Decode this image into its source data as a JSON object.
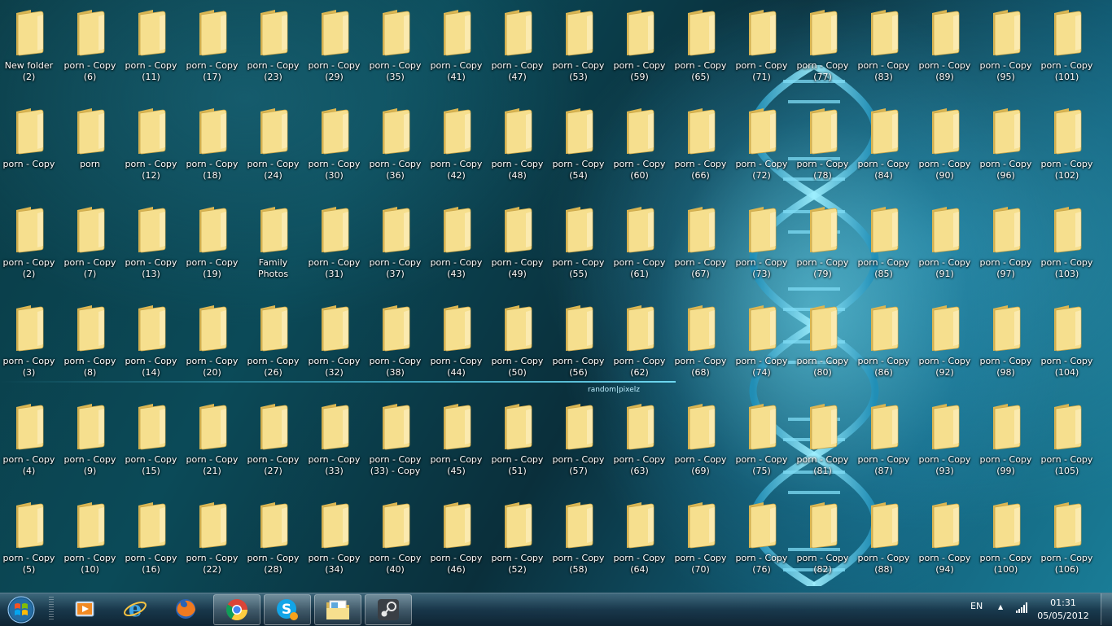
{
  "desktop": {
    "columns": [
      [
        "New folder\n(2)",
        "porn - Copy",
        "porn - Copy\n(2)",
        "porn - Copy\n(3)",
        "porn - Copy\n(4)",
        "porn - Copy\n(5)"
      ],
      [
        "porn - Copy\n(6)",
        "porn",
        "porn - Copy\n(7)",
        "porn - Copy\n(8)",
        "porn - Copy\n(9)",
        "porn - Copy\n(10)"
      ],
      [
        "porn - Copy\n(11)",
        "porn - Copy\n(12)",
        "porn - Copy\n(13)",
        "porn - Copy\n(14)",
        "porn - Copy\n(15)",
        "porn - Copy\n(16)"
      ],
      [
        "porn - Copy\n(17)",
        "porn - Copy\n(18)",
        "porn - Copy\n(19)",
        "porn - Copy\n(20)",
        "porn - Copy\n(21)",
        "porn - Copy\n(22)"
      ],
      [
        "porn - Copy\n(23)",
        "porn - Copy\n(24)",
        "Family\nPhotos",
        "porn - Copy\n(26)",
        "porn - Copy\n(27)",
        "porn - Copy\n(28)"
      ],
      [
        "porn - Copy\n(29)",
        "porn - Copy\n(30)",
        "porn - Copy\n(31)",
        "porn - Copy\n(32)",
        "porn - Copy\n(33)",
        "porn - Copy\n(34)"
      ],
      [
        "porn - Copy\n(35)",
        "porn - Copy\n(36)",
        "porn - Copy\n(37)",
        "porn - Copy\n(38)",
        "porn - Copy\n(33) - Copy",
        "porn - Copy\n(40)"
      ],
      [
        "porn - Copy\n(41)",
        "porn - Copy\n(42)",
        "porn - Copy\n(43)",
        "porn - Copy\n(44)",
        "porn - Copy\n(45)",
        "porn - Copy\n(46)"
      ],
      [
        "porn - Copy\n(47)",
        "porn - Copy\n(48)",
        "porn - Copy\n(49)",
        "porn - Copy\n(50)",
        "porn - Copy\n(51)",
        "porn - Copy\n(52)"
      ],
      [
        "porn - Copy\n(53)",
        "porn - Copy\n(54)",
        "porn - Copy\n(55)",
        "porn - Copy\n(56)",
        "porn - Copy\n(57)",
        "porn - Copy\n(58)"
      ],
      [
        "porn - Copy\n(59)",
        "porn - Copy\n(60)",
        "porn - Copy\n(61)",
        "porn - Copy\n(62)",
        "porn - Copy\n(63)",
        "porn - Copy\n(64)"
      ],
      [
        "porn - Copy\n(65)",
        "porn - Copy\n(66)",
        "porn - Copy\n(67)",
        "porn - Copy\n(68)",
        "porn - Copy\n(69)",
        "porn - Copy\n(70)"
      ],
      [
        "porn - Copy\n(71)",
        "porn - Copy\n(72)",
        "porn - Copy\n(73)",
        "porn - Copy\n(74)",
        "porn - Copy\n(75)",
        "porn - Copy\n(76)"
      ],
      [
        "porn - Copy\n(77)",
        "porn - Copy\n(78)",
        "porn - Copy\n(79)",
        "porn - Copy\n(80)",
        "porn - Copy\n(81)",
        "porn - Copy\n(82)"
      ],
      [
        "porn - Copy\n(83)",
        "porn - Copy\n(84)",
        "porn - Copy\n(85)",
        "porn - Copy\n(86)",
        "porn - Copy\n(87)",
        "porn - Copy\n(88)"
      ],
      [
        "porn - Copy\n(89)",
        "porn - Copy\n(90)",
        "porn - Copy\n(91)",
        "porn - Copy\n(92)",
        "porn - Copy\n(93)",
        "porn - Copy\n(94)"
      ],
      [
        "porn - Copy\n(95)",
        "porn - Copy\n(96)",
        "porn - Copy\n(97)",
        "porn - Copy\n(98)",
        "porn - Copy\n(99)",
        "porn - Copy\n(100)"
      ],
      [
        "porn - Copy\n(101)",
        "porn - Copy\n(102)",
        "porn - Copy\n(103)",
        "porn - Copy\n(104)",
        "porn - Copy\n(105)",
        "porn - Copy\n(106)"
      ]
    ]
  },
  "wallpaper": {
    "brand_text": "random|pixelz"
  },
  "taskbar": {
    "start_icon": "windows-logo-icon",
    "pinned": [
      {
        "name": "media-player-icon",
        "active": false
      },
      {
        "name": "internet-explorer-icon",
        "active": false
      },
      {
        "name": "firefox-icon",
        "active": false
      },
      {
        "name": "chrome-icon",
        "active": true
      },
      {
        "name": "skype-icon",
        "active": true
      },
      {
        "name": "windows-explorer-icon",
        "active": true
      },
      {
        "name": "steam-icon",
        "active": true
      }
    ],
    "tray": {
      "language": "EN",
      "time": "01:31",
      "date": "05/05/2012"
    }
  },
  "colors": {
    "folder_light": "#f6df8e",
    "folder_dark": "#d9b653",
    "accent": "#58c8e8"
  }
}
